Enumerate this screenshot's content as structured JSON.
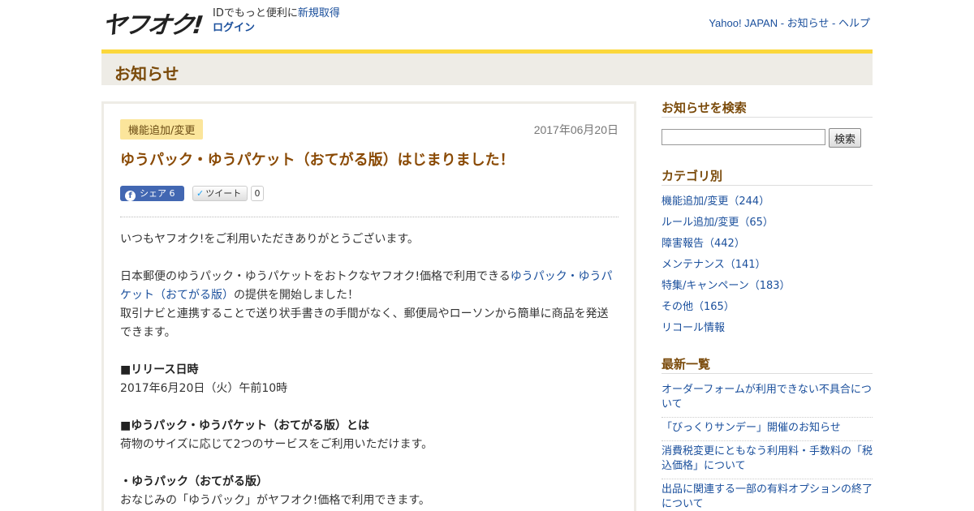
{
  "header": {
    "logo_text": "ヤフオク!",
    "id_prompt": "IDでもっと便利に",
    "signup_link": "新規取得",
    "login_link": "ログイン",
    "links": [
      "Yahoo! JAPAN",
      "お知らせ",
      "ヘルプ"
    ],
    "link_separator": " - "
  },
  "page_title": "お知らせ",
  "article": {
    "category": "機能追加/変更",
    "date": "2017年06月20日",
    "title": "ゆうパック・ゆうパケット（おてがる版）はじまりました！",
    "share": {
      "fb_label": "シェア",
      "fb_count": "6",
      "tweet_label": "ツイート",
      "tweet_count": "0"
    },
    "body": {
      "p1": "いつもヤフオク!をご利用いただきありがとうございます。",
      "p2_before": "日本郵便のゆうパック・ゆうパケットをおトクなヤフオク!価格で利用できる",
      "p2_link": "ゆうパック・ゆうパケット（おてがる版）",
      "p2_after": "の提供を開始しました！",
      "p3": "取引ナビと連携することで送り状手書きの手間がなく、郵便局やローソンから簡単に商品を発送できます。",
      "release_heading": "■リリース日時",
      "release_date": "2017年6月20日（火）午前10時",
      "about_heading": "■ゆうパック・ゆうパケット（おてがる版）とは",
      "about_text": "荷物のサイズに応じて2つのサービスをご利用いただけます。",
      "yupack_heading": "・ゆうパック（おてがる版）",
      "yupack_text": "おなじみの「ゆうパック」がヤフオク!価格で利用できます。"
    }
  },
  "sidebar": {
    "search_heading": "お知らせを検索",
    "search_value": "",
    "search_button": "検索",
    "category_heading": "カテゴリ別",
    "categories": [
      "機能追加/変更（244）",
      "ルール追加/変更（65）",
      "障害報告（442）",
      "メンテナンス（141）",
      "特集/キャンペーン（183）",
      "その他（165）",
      "リコール情報"
    ],
    "latest_heading": "最新一覧",
    "latest": [
      "オーダーフォームが利用できない不具合について",
      "「びっくりサンデー」開催のお知らせ",
      "消費税変更にともなう利用料・手数料の「税込価格」について",
      "出品に関連する一部の有料オプションの終了について"
    ]
  },
  "colors": {
    "accent_yellow": "#fbd73c",
    "title_brown": "#7a4a0a",
    "link_blue": "#1a4f9c",
    "badge_bg": "#fbe59b"
  }
}
